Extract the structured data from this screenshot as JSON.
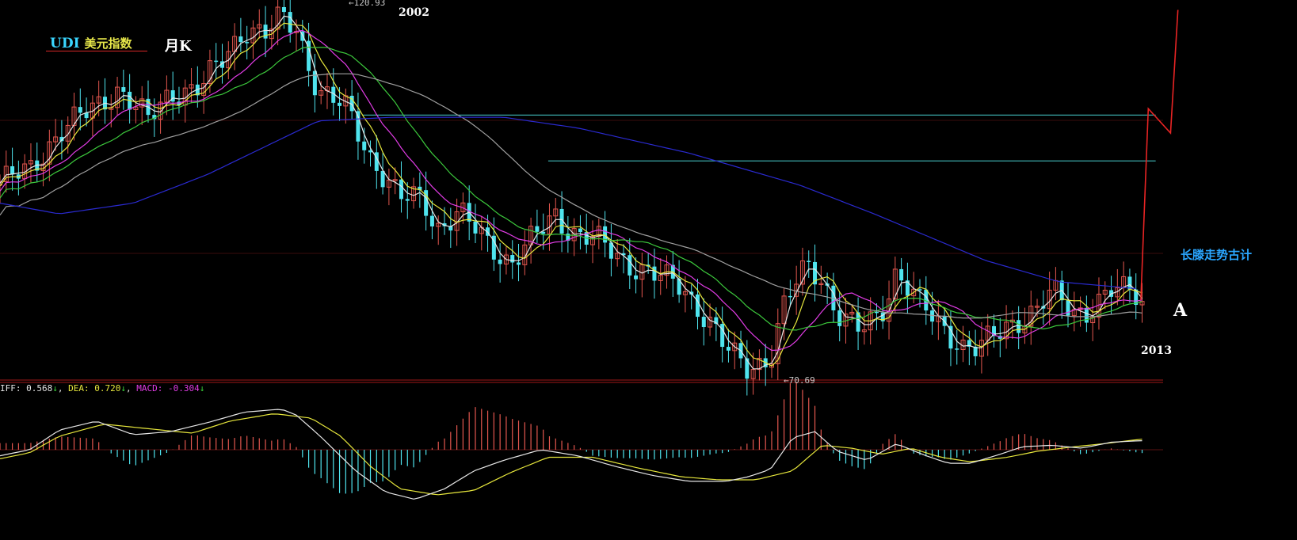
{
  "header": {
    "title": "UDI",
    "title_zh": "美元指数",
    "period": "月K"
  },
  "annotations": {
    "year_peak": "2002",
    "year_end": "2013",
    "marker_a": "A",
    "forecast": "长滕走势古计",
    "high_label": "120.93",
    "low_label": "70.69"
  },
  "macd_legend": {
    "diff_label": "IFF: 0.568",
    "diff_arrow": "↓",
    "dea_label": "DEA: 0.720",
    "dea_arrow": "↓",
    "macd_label": "MACD: -0.304",
    "macd_arrow": "↓",
    "separator": ", "
  },
  "colors": {
    "up": "#e4574f",
    "down": "#4fe4ee",
    "ma_white": "#e6e6e6",
    "ma_yellow": "#e6e63c",
    "ma_magenta": "#e23ce6",
    "ma_green": "#3cc83c",
    "ma_gray": "#a0a0a0",
    "ma_blue": "#2a2ad0",
    "teal_line": "#3aa6a6",
    "forecast_red": "#e82424",
    "macd_label_white": "#e6e6e6",
    "macd_label_yellow": "#e6e63c",
    "macd_label_magenta": "#e23ce6"
  },
  "chart_data": {
    "type": "candlestick",
    "title": "UDI美元指数 月K",
    "x_range": [
      1998.2,
      2013.9
    ],
    "ylim": [
      70,
      122
    ],
    "high": {
      "x": 2002.2,
      "y": 120.93
    },
    "low": {
      "x": 2008.3,
      "y": 70.69
    },
    "price_nodes": [
      [
        1998.2,
        97.5
      ],
      [
        1998.6,
        99.0
      ],
      [
        1999.0,
        104.5
      ],
      [
        1999.5,
        108.0
      ],
      [
        1999.8,
        110.5
      ],
      [
        2000.2,
        106.0
      ],
      [
        2000.5,
        110.0
      ],
      [
        2000.9,
        110.5
      ],
      [
        2001.2,
        114.5
      ],
      [
        2001.5,
        119.0
      ],
      [
        2001.8,
        118.0
      ],
      [
        2002.0,
        120.5
      ],
      [
        2002.2,
        119.0
      ],
      [
        2002.5,
        110.0
      ],
      [
        2002.9,
        107.5
      ],
      [
        2003.2,
        101.0
      ],
      [
        2003.6,
        95.0
      ],
      [
        2003.9,
        95.5
      ],
      [
        2004.1,
        91.0
      ],
      [
        2004.4,
        93.0
      ],
      [
        2004.8,
        89.0
      ],
      [
        2005.1,
        86.0
      ],
      [
        2005.4,
        89.5
      ],
      [
        2005.7,
        93.0
      ],
      [
        2005.9,
        90.5
      ],
      [
        2006.3,
        89.0
      ],
      [
        2006.7,
        86.0
      ],
      [
        2007.0,
        84.5
      ],
      [
        2007.4,
        83.0
      ],
      [
        2007.8,
        77.5
      ],
      [
        2008.0,
        74.0
      ],
      [
        2008.3,
        71.5
      ],
      [
        2008.6,
        73.0
      ],
      [
        2008.8,
        80.5
      ],
      [
        2009.1,
        86.0
      ],
      [
        2009.3,
        84.0
      ],
      [
        2009.5,
        79.0
      ],
      [
        2009.8,
        76.5
      ],
      [
        2010.1,
        79.5
      ],
      [
        2010.3,
        85.0
      ],
      [
        2010.6,
        80.5
      ],
      [
        2010.9,
        77.5
      ],
      [
        2011.2,
        74.5
      ],
      [
        2011.4,
        74.0
      ],
      [
        2011.8,
        77.5
      ],
      [
        2012.2,
        79.5
      ],
      [
        2012.4,
        82.0
      ],
      [
        2012.7,
        79.5
      ],
      [
        2012.9,
        79.5
      ],
      [
        2013.2,
        82.0
      ],
      [
        2013.5,
        82.5
      ],
      [
        2013.6,
        81.0
      ]
    ],
    "moving_averages": [
      {
        "name": "MA-white",
        "color_key": "ma_white",
        "smoothing": 3
      },
      {
        "name": "MA-yellow",
        "color_key": "ma_yellow",
        "smoothing": 6
      },
      {
        "name": "MA-magenta",
        "color_key": "ma_magenta",
        "smoothing": 12
      },
      {
        "name": "MA-green",
        "color_key": "ma_green",
        "smoothing": 20
      },
      {
        "name": "MA-gray",
        "color_key": "ma_gray",
        "smoothing": 40
      },
      {
        "name": "MA-blue",
        "nodes": [
          [
            1998.2,
            94.5
          ],
          [
            1999.0,
            93.0
          ],
          [
            2000.0,
            94.5
          ],
          [
            2001.0,
            98.5
          ],
          [
            2002.0,
            103.5
          ],
          [
            2002.5,
            106.0
          ],
          [
            2003.5,
            106.5
          ],
          [
            2005.0,
            106.5
          ],
          [
            2006.0,
            105.0
          ],
          [
            2007.5,
            101.5
          ],
          [
            2009.0,
            97.0
          ],
          [
            2010.0,
            93.0
          ],
          [
            2011.5,
            86.5
          ],
          [
            2012.5,
            83.5
          ],
          [
            2013.6,
            82.5
          ]
        ],
        "color_key": "ma_blue"
      }
    ],
    "horizontal_lines": [
      {
        "y": 106.8,
        "x_from": 2003.1,
        "x_to": 2013.8,
        "color_key": "teal_line"
      },
      {
        "y": 100.4,
        "x_from": 2005.6,
        "x_to": 2013.8,
        "color_key": "teal_line"
      }
    ],
    "forecast_path": [
      [
        2013.6,
        81.0
      ],
      [
        2013.7,
        107.7
      ],
      [
        2014.0,
        104.3
      ],
      [
        2014.1,
        121.5
      ]
    ],
    "macd": {
      "diff": 0.568,
      "dea": 0.72,
      "macd": -0.304,
      "diff_nodes": [
        [
          1998.2,
          -0.4
        ],
        [
          1998.6,
          0.0
        ],
        [
          1999.0,
          1.3
        ],
        [
          1999.5,
          1.9
        ],
        [
          2000.0,
          1.0
        ],
        [
          2000.5,
          1.2
        ],
        [
          2001.0,
          1.8
        ],
        [
          2001.5,
          2.5
        ],
        [
          2002.0,
          2.7
        ],
        [
          2002.2,
          2.3
        ],
        [
          2002.5,
          1.0
        ],
        [
          2003.0,
          -1.4
        ],
        [
          2003.4,
          -2.8
        ],
        [
          2003.8,
          -3.3
        ],
        [
          2004.2,
          -2.6
        ],
        [
          2004.6,
          -1.4
        ],
        [
          2005.0,
          -0.7
        ],
        [
          2005.5,
          0.0
        ],
        [
          2006.0,
          -0.4
        ],
        [
          2006.5,
          -1.1
        ],
        [
          2007.0,
          -1.7
        ],
        [
          2007.5,
          -2.1
        ],
        [
          2008.0,
          -2.1
        ],
        [
          2008.3,
          -1.8
        ],
        [
          2008.6,
          -1.3
        ],
        [
          2008.9,
          0.8
        ],
        [
          2009.2,
          1.2
        ],
        [
          2009.5,
          -0.1
        ],
        [
          2009.9,
          -0.7
        ],
        [
          2010.3,
          0.4
        ],
        [
          2010.7,
          -0.4
        ],
        [
          2011.0,
          -0.9
        ],
        [
          2011.3,
          -0.9
        ],
        [
          2011.7,
          -0.3
        ],
        [
          2012.0,
          0.2
        ],
        [
          2012.4,
          0.3
        ],
        [
          2012.8,
          0.1
        ],
        [
          2013.2,
          0.5
        ],
        [
          2013.6,
          0.6
        ]
      ],
      "dea_nodes": [
        [
          1998.2,
          -0.6
        ],
        [
          1998.6,
          -0.2
        ],
        [
          1999.0,
          0.9
        ],
        [
          1999.6,
          1.7
        ],
        [
          2000.2,
          1.4
        ],
        [
          2000.8,
          1.1
        ],
        [
          2001.3,
          1.9
        ],
        [
          2001.9,
          2.4
        ],
        [
          2002.4,
          2.1
        ],
        [
          2002.8,
          0.9
        ],
        [
          2003.2,
          -1.1
        ],
        [
          2003.6,
          -2.6
        ],
        [
          2004.1,
          -3.0
        ],
        [
          2004.6,
          -2.7
        ],
        [
          2005.1,
          -1.5
        ],
        [
          2005.6,
          -0.5
        ],
        [
          2006.2,
          -0.5
        ],
        [
          2006.8,
          -1.2
        ],
        [
          2007.4,
          -1.8
        ],
        [
          2007.9,
          -2.0
        ],
        [
          2008.4,
          -2.0
        ],
        [
          2008.9,
          -1.4
        ],
        [
          2009.3,
          0.3
        ],
        [
          2009.7,
          0.1
        ],
        [
          2010.1,
          -0.3
        ],
        [
          2010.5,
          0.1
        ],
        [
          2010.9,
          -0.5
        ],
        [
          2011.3,
          -0.8
        ],
        [
          2011.8,
          -0.5
        ],
        [
          2012.2,
          -0.1
        ],
        [
          2012.7,
          0.2
        ],
        [
          2013.1,
          0.4
        ],
        [
          2013.6,
          0.7
        ]
      ]
    }
  }
}
